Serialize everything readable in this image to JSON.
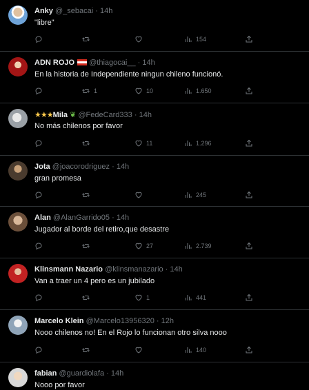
{
  "tweets": [
    {
      "name": "Anky",
      "handle": "@_sebacai",
      "time": "14h",
      "text": "\"libre\"",
      "replies": "",
      "retweets": "",
      "likes": "",
      "views": "154",
      "avatar_color": "#5b7fb4"
    },
    {
      "name": "ADN ROJO",
      "handle": "@thiagocai__",
      "time": "14h",
      "text": "En la historia de Independiente ningun chileno funcionó.",
      "replies": "",
      "retweets": "1",
      "likes": "10",
      "views": "1.650",
      "avatar_color": "#a31515"
    },
    {
      "name": "Mila",
      "handle": "@FedeCard333",
      "time": "14h",
      "text": "No más chilenos por favor",
      "replies": "",
      "retweets": "",
      "likes": "11",
      "views": "1.296",
      "avatar_color": "#c7c7c7"
    },
    {
      "name": "Jota",
      "handle": "@joacorodriguez",
      "time": "14h",
      "text": "gran promesa",
      "replies": "",
      "retweets": "",
      "likes": "",
      "views": "245",
      "avatar_color": "#4a3b2e"
    },
    {
      "name": "Alan",
      "handle": "@AlanGarrido05",
      "time": "14h",
      "text": "Jugador al borde del retiro,que desastre",
      "replies": "",
      "retweets": "",
      "likes": "27",
      "views": "2.739",
      "avatar_color": "#b38a6a"
    },
    {
      "name": "Klinsmann Nazario",
      "handle": "@klinsmanazario",
      "time": "14h",
      "text": "Van a traer un 4 pero es un jubilado",
      "replies": "",
      "retweets": "",
      "likes": "1",
      "views": "441",
      "avatar_color": "#c22222"
    },
    {
      "name": "Marcelo Klein",
      "handle": "@Marcelo13956320",
      "time": "12h",
      "text": "Nooo chilenos no! En el Rojo lo funcionan otro silva nooo",
      "replies": "",
      "retweets": "",
      "likes": "",
      "views": "140",
      "avatar_color": "#8fa4b8"
    },
    {
      "name": "fabian",
      "handle": "@guardiolafa",
      "time": "14h",
      "text": "Nooo por favor",
      "replies": "",
      "retweets": "",
      "likes": "",
      "views": "",
      "avatar_color": "#d8d8d8"
    }
  ],
  "colors": {
    "background": "#000000",
    "text": "#e7e9ea",
    "muted": "#71767b",
    "border": "#2f3336"
  },
  "icons": [
    "reply-icon",
    "retweet-icon",
    "like-icon",
    "views-icon",
    "share-icon"
  ]
}
